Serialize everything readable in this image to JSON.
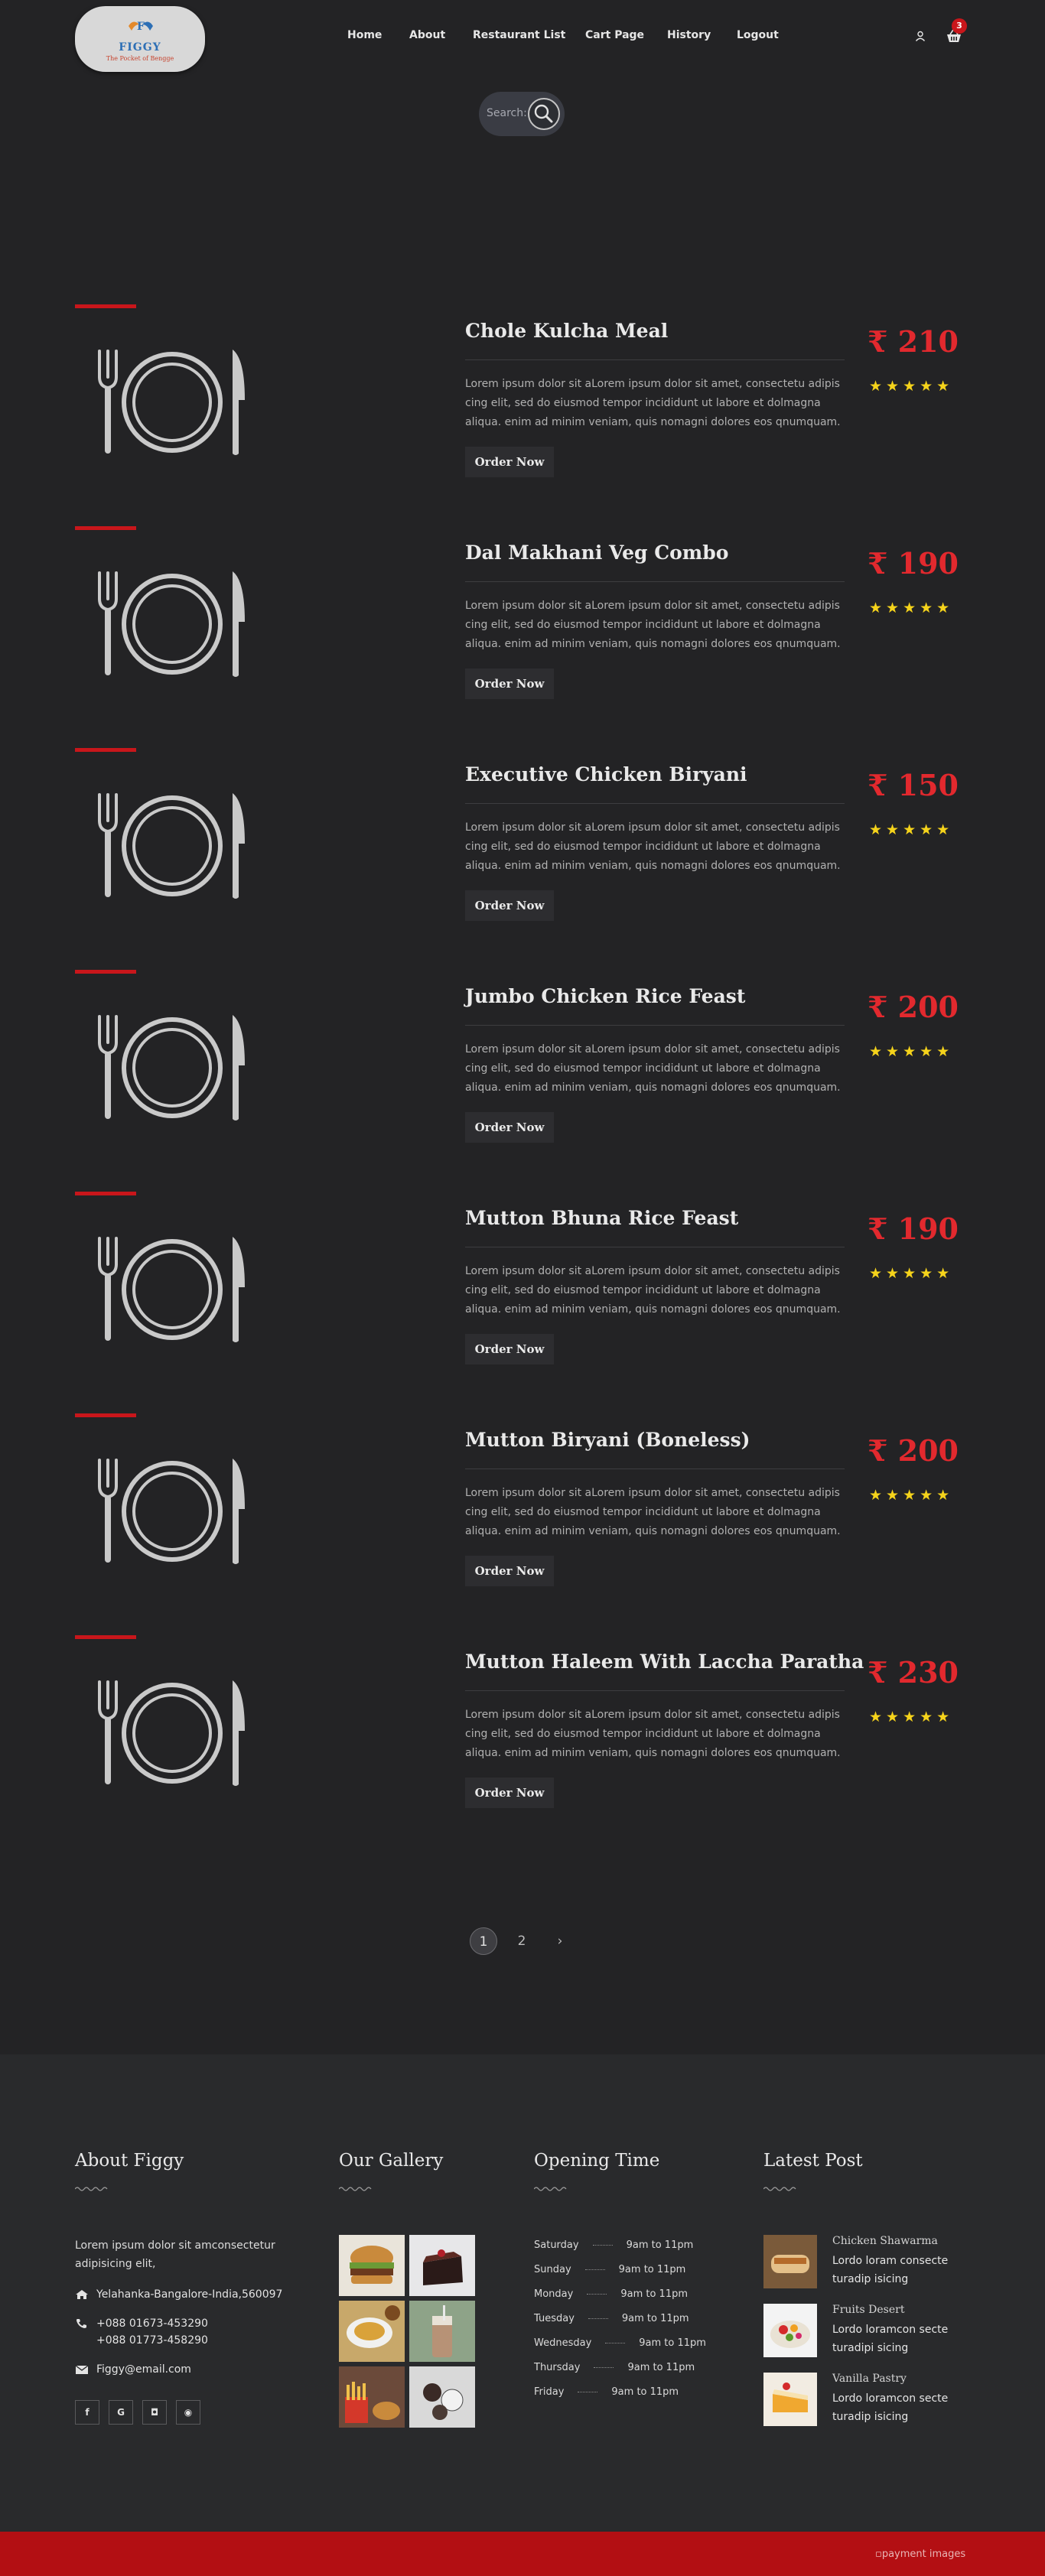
{
  "brand": {
    "name": "FIGGY",
    "tagline": "The Pocket of Bengge",
    "logo_letter": "F"
  },
  "nav": {
    "items": [
      "Home",
      "About",
      "Restaurant List",
      "Cart Page",
      "History",
      "Logout"
    ]
  },
  "cart": {
    "count": "3"
  },
  "search": {
    "label": "Search:"
  },
  "menu": {
    "order_label": "Order Now",
    "stars": "★★★★★",
    "description": "Lorem ipsum dolor sit aLorem ipsum dolor sit amet, consectetu adipis cing elit, sed do eiusmod tempor incididunt ut labore et dolmagna aliqua. enim ad minim veniam, quis nomagni dolores eos qnumquam.",
    "items": [
      {
        "name": "Chole Kulcha Meal",
        "price": "₹ 210"
      },
      {
        "name": "Dal Makhani Veg Combo",
        "price": "₹ 190"
      },
      {
        "name": "Executive Chicken Biryani",
        "price": "₹ 150"
      },
      {
        "name": "Jumbo Chicken Rice Feast",
        "price": "₹ 200"
      },
      {
        "name": "Mutton Bhuna Rice Feast",
        "price": "₹ 190"
      },
      {
        "name": "Mutton Biryani (Boneless)",
        "price": "₹ 200"
      },
      {
        "name": "Mutton Haleem With Laccha Paratha",
        "price": "₹ 230"
      }
    ]
  },
  "pagination": {
    "pages": [
      "1",
      "2"
    ],
    "next": "›",
    "current": "1"
  },
  "footer": {
    "about": {
      "title": "About Figgy",
      "text": "Lorem ipsum dolor sit amconsectetur adipisicing elit,",
      "address": "Yelahanka-Bangalore-India,560097",
      "phone1": "+088 01673-453290",
      "phone2": "+088 01773-458290",
      "email": "Figgy@email.com",
      "social": [
        "f",
        "G",
        "◘",
        "◉"
      ]
    },
    "gallery": {
      "title": "Our Gallery"
    },
    "hours": {
      "title": "Opening Time",
      "rows": [
        {
          "day": "Saturday",
          "time": "9am to 11pm"
        },
        {
          "day": "Sunday",
          "time": "9am to 11pm"
        },
        {
          "day": "Monday",
          "time": "9am to 11pm"
        },
        {
          "day": "Tuesday",
          "time": "9am to 11pm"
        },
        {
          "day": "Wednesday",
          "time": "9am to 11pm"
        },
        {
          "day": "Thursday",
          "time": "9am to 11pm"
        },
        {
          "day": "Friday",
          "time": "9am to 11pm"
        }
      ]
    },
    "posts": {
      "title": "Latest Post",
      "items": [
        {
          "title": "Chicken Shawarma",
          "text": "Lordo loram consecte turadip isicing"
        },
        {
          "title": "Fruits Desert",
          "text": "Lordo loramcon secte turadipi sicing"
        },
        {
          "title": "Vanilla Pastry",
          "text": "Lordo loramcon secte turadip isicing"
        }
      ]
    }
  },
  "bottom": {
    "payment_alt": "payment images"
  },
  "colors": {
    "accent": "#c8161b",
    "price": "#e2292e",
    "stars": "#f5d31b",
    "background": "#232325"
  }
}
